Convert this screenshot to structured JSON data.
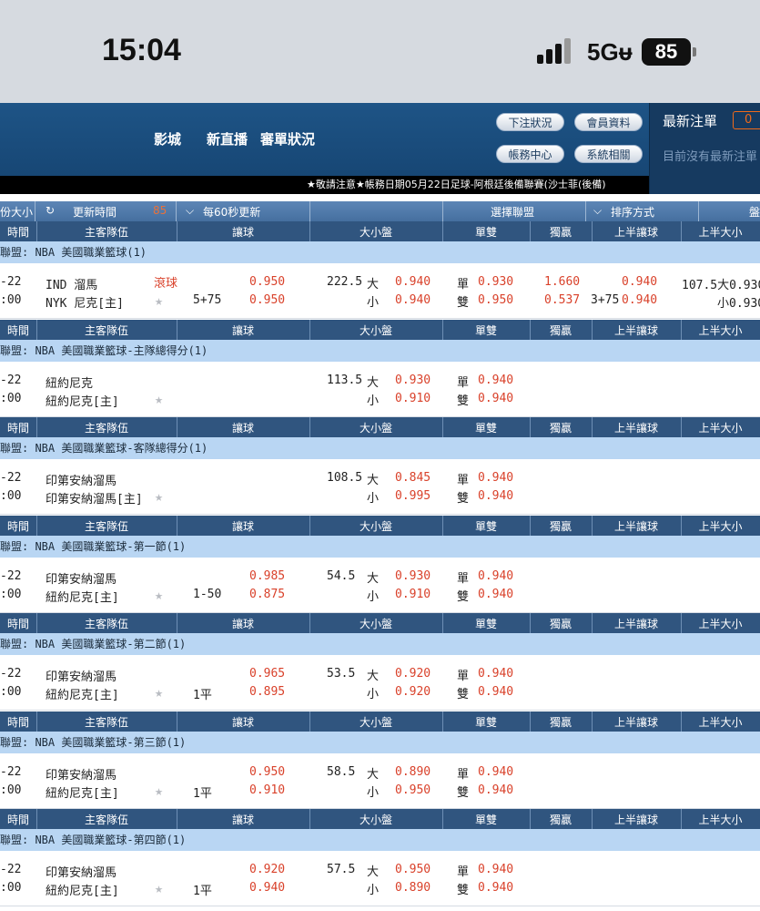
{
  "status_bar": {
    "time": "15:04",
    "network": "5Gᵾ",
    "battery": "85"
  },
  "header": {
    "nav": [
      "影城",
      "新直播",
      "審單狀況"
    ],
    "buttons": [
      "下注狀況",
      "會員資料",
      "帳務中心",
      "系統相關"
    ],
    "latest_title": "最新注單",
    "latest_count": "0",
    "latest_empty": "目前沒有最新注單",
    "ticker": "★敬請注意★帳務日期05月22日足球-阿根廷後備聯賽(沙士菲(後備)"
  },
  "toolbar": {
    "font_size": "份大小",
    "refresh_time": "更新時間",
    "refresh_value": "85",
    "auto_refresh": "每60秒更新",
    "choose_league": "選擇聯盟",
    "sort": "排序方式",
    "market": "盤"
  },
  "columns": [
    "時間",
    "主客隊伍",
    "讓球",
    "大小盤",
    "單雙",
    "獨贏",
    "上半讓球",
    "上半大小"
  ],
  "sections": [
    {
      "league": "聯盟: NBA 美國職業籃球(1)",
      "date": "-22",
      "time": ":00",
      "team1": "IND 溜馬",
      "team2": "NYK 尼克[主]",
      "live": "滾球",
      "handicap": "5+75",
      "hc1": "0.950",
      "hc2": "0.950",
      "ou_line": "222.5",
      "ou1_label": "大",
      "ou1": "0.940",
      "ou2_label": "小",
      "ou2": "0.940",
      "odd_label": "單",
      "odd": "0.930",
      "even_label": "雙",
      "even": "0.950",
      "ml1": "1.660",
      "ml2": "0.537",
      "h_hc1": "0.940",
      "h_hc_line": "3+75",
      "h_hc2": "0.940",
      "h_ou1": "107.5大0.930",
      "h_ou2": "小0.930"
    },
    {
      "league": "聯盟: NBA 美國職業籃球-主隊總得分(1)",
      "date": "-22",
      "time": ":00",
      "team1": "紐約尼克",
      "team2": "紐約尼克[主]",
      "live": "",
      "handicap": "",
      "hc1": "",
      "hc2": "",
      "ou_line": "113.5",
      "ou1_label": "大",
      "ou1": "0.930",
      "ou2_label": "小",
      "ou2": "0.910",
      "odd_label": "單",
      "odd": "0.940",
      "even_label": "雙",
      "even": "0.940",
      "ml1": "",
      "ml2": "",
      "h_hc1": "",
      "h_hc_line": "",
      "h_hc2": "",
      "h_ou1": "",
      "h_ou2": ""
    },
    {
      "league": "聯盟: NBA 美國職業籃球-客隊總得分(1)",
      "date": "-22",
      "time": ":00",
      "team1": "印第安納溜馬",
      "team2": "印第安納溜馬[主]",
      "live": "",
      "handicap": "",
      "hc1": "",
      "hc2": "",
      "ou_line": "108.5",
      "ou1_label": "大",
      "ou1": "0.845",
      "ou2_label": "小",
      "ou2": "0.995",
      "odd_label": "單",
      "odd": "0.940",
      "even_label": "雙",
      "even": "0.940",
      "ml1": "",
      "ml2": "",
      "h_hc1": "",
      "h_hc_line": "",
      "h_hc2": "",
      "h_ou1": "",
      "h_ou2": ""
    },
    {
      "league": "聯盟: NBA 美國職業籃球-第一節(1)",
      "date": "-22",
      "time": ":00",
      "team1": "印第安納溜馬",
      "team2": "紐約尼克[主]",
      "live": "",
      "handicap": "1-50",
      "hc1": "0.985",
      "hc2": "0.875",
      "ou_line": "54.5",
      "ou1_label": "大",
      "ou1": "0.930",
      "ou2_label": "小",
      "ou2": "0.910",
      "odd_label": "單",
      "odd": "0.940",
      "even_label": "雙",
      "even": "0.940",
      "ml1": "",
      "ml2": "",
      "h_hc1": "",
      "h_hc_line": "",
      "h_hc2": "",
      "h_ou1": "",
      "h_ou2": ""
    },
    {
      "league": "聯盟: NBA 美國職業籃球-第二節(1)",
      "date": "-22",
      "time": ":00",
      "team1": "印第安納溜馬",
      "team2": "紐約尼克[主]",
      "live": "",
      "handicap": "1平",
      "hc1": "0.965",
      "hc2": "0.895",
      "ou_line": "53.5",
      "ou1_label": "大",
      "ou1": "0.920",
      "ou2_label": "小",
      "ou2": "0.920",
      "odd_label": "單",
      "odd": "0.940",
      "even_label": "雙",
      "even": "0.940",
      "ml1": "",
      "ml2": "",
      "h_hc1": "",
      "h_hc_line": "",
      "h_hc2": "",
      "h_ou1": "",
      "h_ou2": ""
    },
    {
      "league": "聯盟: NBA 美國職業籃球-第三節(1)",
      "date": "-22",
      "time": ":00",
      "team1": "印第安納溜馬",
      "team2": "紐約尼克[主]",
      "live": "",
      "handicap": "1平",
      "hc1": "0.950",
      "hc2": "0.910",
      "ou_line": "58.5",
      "ou1_label": "大",
      "ou1": "0.890",
      "ou2_label": "小",
      "ou2": "0.950",
      "odd_label": "單",
      "odd": "0.940",
      "even_label": "雙",
      "even": "0.940",
      "ml1": "",
      "ml2": "",
      "h_hc1": "",
      "h_hc_line": "",
      "h_hc2": "",
      "h_ou1": "",
      "h_ou2": ""
    },
    {
      "league": "聯盟: NBA 美國職業籃球-第四節(1)",
      "date": "-22",
      "time": ":00",
      "team1": "印第安納溜馬",
      "team2": "紐約尼克[主]",
      "live": "",
      "handicap": "1平",
      "hc1": "0.920",
      "hc2": "0.940",
      "ou_line": "57.5",
      "ou1_label": "大",
      "ou1": "0.950",
      "ou2_label": "小",
      "ou2": "0.890",
      "odd_label": "單",
      "odd": "0.940",
      "even_label": "雙",
      "even": "0.940",
      "ml1": "",
      "ml2": "",
      "h_hc1": "",
      "h_hc_line": "",
      "h_hc2": "",
      "h_ou1": "",
      "h_ou2": ""
    }
  ]
}
